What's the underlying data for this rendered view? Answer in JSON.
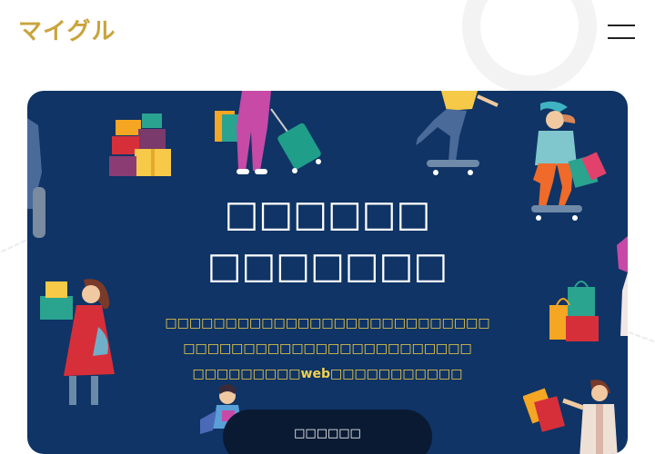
{
  "header": {
    "logo_text": "マイグル",
    "menu_icon": "hamburger-menu-icon"
  },
  "hero": {
    "title_lines": [
      "□□□□□□",
      "□□□□□□□"
    ],
    "description_lines": [
      "□□□□□□□□□□□□□□□□□□□□□□□□□□□",
      "□□□□□□□□□□□□□□□□□□□□□□□□",
      "□□□□□□□□□web□□□□□□□□□□□"
    ],
    "button_label": "□□□□□□",
    "illustrations": [
      "gift-boxes-stack-icon",
      "shopper-with-suitcase-icon",
      "skateboarder-icon",
      "skateboarder-with-shopping-bags-icon",
      "woman-holding-gift-icon",
      "shopping-bags-icon",
      "shopper-with-bags-icon",
      "person-on-scooter-icon"
    ]
  },
  "colors": {
    "brand": "#c9a43c",
    "hero_bg": "#0f3465",
    "accent_text": "#f4d14d",
    "button_bg": "#0a1a33"
  }
}
